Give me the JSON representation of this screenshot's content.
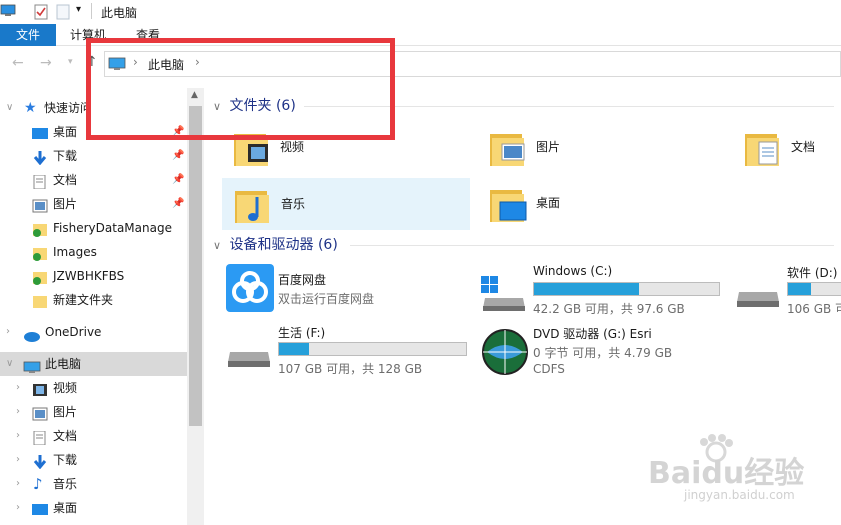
{
  "window": {
    "title": "此电脑"
  },
  "ribbon": {
    "tabs": [
      "文件",
      "计算机",
      "查看"
    ]
  },
  "address": {
    "segments": [
      "此电脑"
    ],
    "separator": "›"
  },
  "nav": {
    "quick_access": "快速访问",
    "items": [
      {
        "label": "桌面",
        "icon": "desktop-icon",
        "pinned": true
      },
      {
        "label": "下载",
        "icon": "download-icon",
        "pinned": true
      },
      {
        "label": "文档",
        "icon": "document-icon",
        "pinned": true
      },
      {
        "label": "图片",
        "icon": "pictures-icon",
        "pinned": true
      },
      {
        "label": "FisheryDataManage",
        "icon": "folder-icon",
        "pinned": false
      },
      {
        "label": "Images",
        "icon": "folder-icon",
        "pinned": false
      },
      {
        "label": "JZWBHKFBS",
        "icon": "folder-icon",
        "pinned": false
      },
      {
        "label": "新建文件夹",
        "icon": "folder-icon",
        "pinned": false
      }
    ],
    "onedrive": "OneDrive",
    "this_pc": "此电脑",
    "pc_items": [
      {
        "label": "视频",
        "icon": "video-icon"
      },
      {
        "label": "图片",
        "icon": "pictures-icon"
      },
      {
        "label": "文档",
        "icon": "document-icon"
      },
      {
        "label": "下载",
        "icon": "download-icon"
      },
      {
        "label": "音乐",
        "icon": "music-icon"
      },
      {
        "label": "桌面",
        "icon": "desktop-icon"
      }
    ]
  },
  "folders": {
    "header": "文件夹 (6)",
    "items": [
      {
        "label": "视频",
        "icon": "video-folder-icon"
      },
      {
        "label": "图片",
        "icon": "pictures-folder-icon"
      },
      {
        "label": "文档",
        "icon": "documents-folder-icon"
      },
      {
        "label": "音乐",
        "icon": "music-folder-icon",
        "selected": true
      },
      {
        "label": "桌面",
        "icon": "desktop-folder-icon"
      }
    ]
  },
  "devices": {
    "header": "设备和驱动器 (6)",
    "items": [
      {
        "name": "百度网盘",
        "sub": "双击运行百度网盘",
        "icon": "baidu-netdisk-icon"
      },
      {
        "name": "Windows (C:)",
        "sub": "42.2 GB 可用，共 97.6 GB",
        "used_fraction": 0.57,
        "icon": "windows-drive-icon"
      },
      {
        "name": "软件 (D:)",
        "sub": "106 GB 可用",
        "used_fraction": 0.4,
        "icon": "drive-icon"
      },
      {
        "name": "生活 (F:)",
        "sub": "107 GB 可用，共 128 GB",
        "used_fraction": 0.16,
        "icon": "drive-icon"
      },
      {
        "name": "DVD 驱动器 (G:) Esri",
        "sub": "0 字节 可用，共 4.79 GB",
        "sub2": "CDFS",
        "icon": "dvd-globe-icon"
      }
    ]
  },
  "watermark": {
    "text": "Baidu经验",
    "url": "jingyan.baidu.com"
  },
  "colors": {
    "accent": "#1979ca",
    "selection": "#cce8ff",
    "bar_fill": "#26a0da",
    "highlight": "#e8383d"
  }
}
